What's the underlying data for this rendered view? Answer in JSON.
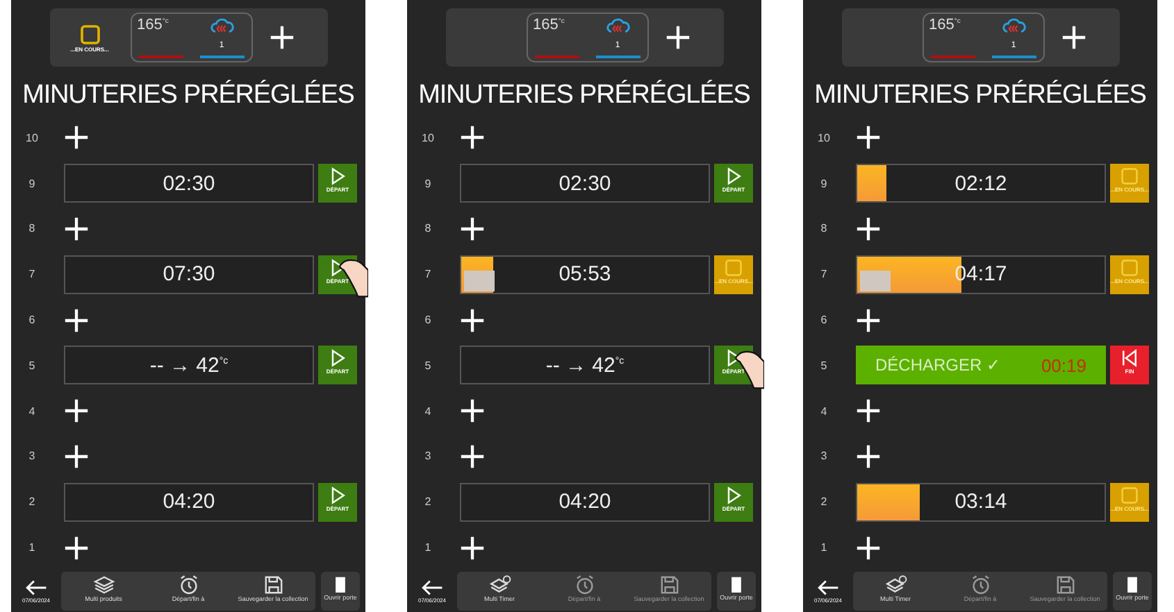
{
  "screens": [
    {
      "top_bar": {
        "status": {
          "label": "...EN COURS..."
        },
        "temperature": "165$^{°c}$",
        "count": "1"
      },
      "title": "MINUTERIES PRÉRÉGLÉES",
      "rows": [
        {
          "number": "10",
          "kind": "add"
        },
        {
          "number": "9",
          "kind": "timer",
          "time": "02:30",
          "action": {
            "kind": "start",
            "label": "DÉPART"
          }
        },
        {
          "number": "8",
          "kind": "add"
        },
        {
          "number": "7",
          "kind": "timer",
          "time": "07:30",
          "action": {
            "kind": "start",
            "label": "DÉPART"
          },
          "touched": true
        },
        {
          "number": "6",
          "kind": "add"
        },
        {
          "number": "5",
          "kind": "timer",
          "time": "-- → 42$^{°c}$",
          "action": {
            "kind": "start",
            "label": "DÉPART"
          }
        },
        {
          "number": "4",
          "kind": "add"
        },
        {
          "number": "3",
          "kind": "add"
        },
        {
          "number": "2",
          "kind": "timer",
          "time": "04:20",
          "action": {
            "kind": "start",
            "label": "DÉPART"
          }
        },
        {
          "number": "1",
          "kind": "add"
        }
      ],
      "toolbar": {
        "date": "07/06/2024",
        "tools": [
          {
            "kind": "layers",
            "label": "Multi produits",
            "disabled": false
          },
          {
            "kind": "alarm",
            "label": "Départ/fin à",
            "disabled": false
          },
          {
            "kind": "save",
            "label": "Sauvegarder la collection",
            "disabled": false
          }
        ],
        "door": "Ouvrir porte"
      }
    },
    {
      "top_bar": {
        "temperature": "165$^{°c}$",
        "count": "1"
      },
      "title": "MINUTERIES PRÉRÉGLÉES",
      "rows": [
        {
          "number": "10",
          "kind": "add"
        },
        {
          "number": "9",
          "kind": "timer",
          "time": "02:30",
          "action": {
            "kind": "start",
            "label": "DÉPART"
          }
        },
        {
          "number": "8",
          "kind": "add"
        },
        {
          "number": "7",
          "kind": "timer",
          "time": "05:53",
          "level": 0.13,
          "photo": true,
          "action": {
            "kind": "running",
            "label": "...EN COURS..."
          }
        },
        {
          "number": "6",
          "kind": "add"
        },
        {
          "number": "5",
          "kind": "timer",
          "time": "-- → 42$^{°c}$",
          "action": {
            "kind": "start",
            "label": "DÉPART"
          },
          "touched": true
        },
        {
          "number": "4",
          "kind": "add"
        },
        {
          "number": "3",
          "kind": "add"
        },
        {
          "number": "2",
          "kind": "timer",
          "time": "04:20",
          "action": {
            "kind": "start",
            "label": "DÉPART"
          }
        },
        {
          "number": "1",
          "kind": "add"
        }
      ],
      "toolbar": {
        "date": "07/06/2024",
        "tools": [
          {
            "kind": "timer",
            "label": "Multi Timer",
            "disabled": false
          },
          {
            "kind": "alarm",
            "label": "Départ/fin à",
            "disabled": true
          },
          {
            "kind": "save",
            "label": "Sauvegarder la collection",
            "disabled": true
          }
        ],
        "door": "Ouvrir porte"
      }
    },
    {
      "top_bar": {
        "temperature": "165$^{°c}$",
        "count": "1"
      },
      "title": "MINUTERIES PRÉRÉGLÉES",
      "rows": [
        {
          "number": "10",
          "kind": "add"
        },
        {
          "number": "9",
          "kind": "timer",
          "time": "02:12",
          "level": 0.12,
          "action": {
            "kind": "running",
            "label": "...EN COURS..."
          }
        },
        {
          "number": "8",
          "kind": "add"
        },
        {
          "number": "7",
          "kind": "timer",
          "time": "04:17",
          "level": 0.42,
          "photo": true,
          "action": {
            "kind": "running",
            "label": "...EN COURS..."
          }
        },
        {
          "number": "6",
          "kind": "add"
        },
        {
          "number": "5",
          "kind": "unload",
          "label": "DÉCHARGER ✓",
          "time": "00:19",
          "action": {
            "kind": "end",
            "label": "FIN"
          }
        },
        {
          "number": "4",
          "kind": "add"
        },
        {
          "number": "3",
          "kind": "add"
        },
        {
          "number": "2",
          "kind": "timer",
          "time": "03:14",
          "level": 0.25,
          "action": {
            "kind": "running",
            "label": "...EN COURS..."
          }
        },
        {
          "number": "1",
          "kind": "add"
        }
      ],
      "toolbar": {
        "date": "07/06/2024",
        "tools": [
          {
            "kind": "timer",
            "label": "Multi Timer",
            "disabled": false
          },
          {
            "kind": "alarm",
            "label": "Départ/fin à",
            "disabled": true
          },
          {
            "kind": "save",
            "label": "Sauvegarder la collection",
            "disabled": true
          }
        ],
        "door": "Ouvrir porte"
      }
    }
  ]
}
